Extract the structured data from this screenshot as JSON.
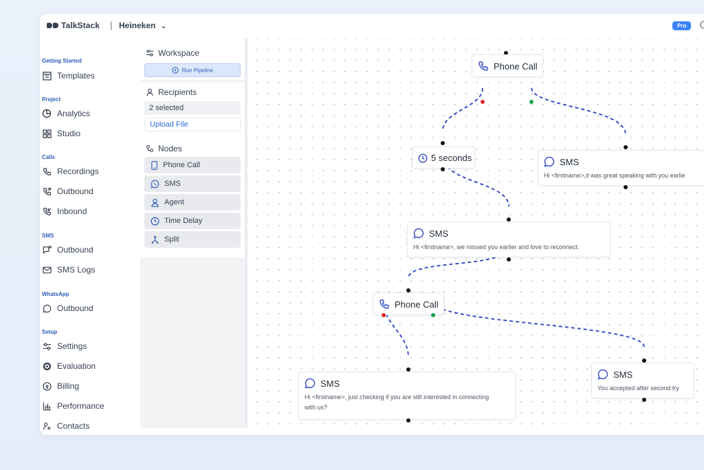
{
  "header": {
    "brand": "TalkStack",
    "separator": "|",
    "workspace": "Heineken",
    "workspace_chevron": "⌄",
    "badge": "Pro"
  },
  "sidebar": {
    "sections": [
      {
        "title": "Getting Started",
        "items": [
          {
            "label": "Templates",
            "icon": "templates-icon"
          }
        ]
      },
      {
        "title": "Project",
        "items": [
          {
            "label": "Analytics",
            "icon": "pie-chart-icon"
          },
          {
            "label": "Studio",
            "icon": "grid-icon"
          }
        ]
      },
      {
        "title": "Calls",
        "items": [
          {
            "label": "Recordings",
            "icon": "phone-icon"
          },
          {
            "label": "Outbound",
            "icon": "phone-outgoing-icon"
          },
          {
            "label": "Inbound",
            "icon": "phone-incoming-icon"
          }
        ]
      },
      {
        "title": "SMS",
        "items": [
          {
            "label": "Outbound",
            "icon": "message-outgoing-icon"
          },
          {
            "label": "SMS Logs",
            "icon": "mail-icon"
          }
        ]
      },
      {
        "title": "WhatsApp",
        "items": [
          {
            "label": "Outbound",
            "icon": "chat-bubble-icon"
          }
        ]
      },
      {
        "title": "Setup",
        "items": [
          {
            "label": "Settings",
            "icon": "sliders-icon"
          },
          {
            "label": "Evaluation",
            "icon": "target-icon"
          },
          {
            "label": "Billing",
            "icon": "dollar-icon"
          },
          {
            "label": "Performance",
            "icon": "bar-chart-icon"
          },
          {
            "label": "Contacts",
            "icon": "contacts-icon"
          }
        ]
      }
    ]
  },
  "panel": {
    "workspace_label": "Workspace",
    "run_pipeline": "Run Pipeline",
    "recipients_label": "Recipients",
    "recipients_value": "2 selected",
    "upload_file": "Upload File",
    "nodes_label": "Nodes",
    "nodes": [
      {
        "label": "Phone Call",
        "icon": "phone-device-icon"
      },
      {
        "label": "SMS",
        "icon": "whatsapp-icon"
      },
      {
        "label": "Agent",
        "icon": "user-icon"
      },
      {
        "label": "Time Delay",
        "icon": "clock-icon"
      },
      {
        "label": "Split",
        "icon": "split-icon"
      }
    ]
  },
  "canvas": {
    "nodes": [
      {
        "id": "call1",
        "type": "Phone Call",
        "title": "Phone Call"
      },
      {
        "id": "delay1",
        "type": "Time Delay",
        "title": "5 seconds"
      },
      {
        "id": "sms_right",
        "type": "SMS",
        "title": "SMS",
        "text": "Hi <firstname>,it was great speaking with you earlie"
      },
      {
        "id": "sms_mid",
        "type": "SMS",
        "title": "SMS",
        "text": "Hi <firstname>, we missed you earlier and love to reconnect."
      },
      {
        "id": "call2",
        "type": "Phone Call",
        "title": "Phone Call"
      },
      {
        "id": "sms_bottom",
        "type": "SMS",
        "title": "SMS",
        "text": "Hi <firstname>, just checking if you are still interested in connecting with us?"
      },
      {
        "id": "sms_br",
        "type": "SMS",
        "title": "SMS",
        "text": "You accepted after second try"
      }
    ]
  },
  "colors": {
    "accent": "#2f5db8",
    "edge": "#3b4fc4",
    "fail_handle": "#e02424",
    "success_handle": "#16a34a",
    "badge": "#3b82f6"
  }
}
